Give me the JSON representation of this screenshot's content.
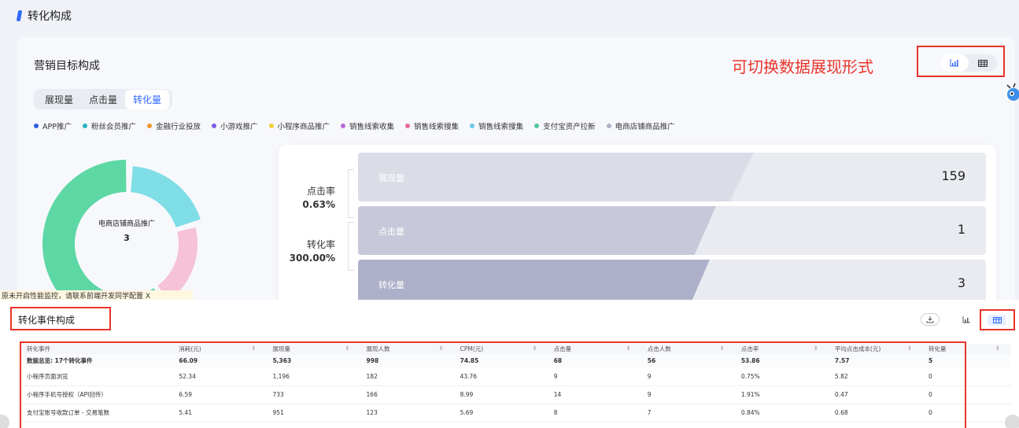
{
  "page": {
    "section_title": "转化构成"
  },
  "top_card": {
    "title": "营销目标构成",
    "annotation": "可切换数据展现形式",
    "view_switch": {
      "chart_icon": "bar-chart-icon",
      "table_icon": "table-grid-icon",
      "active": "chart"
    },
    "tabs": [
      {
        "label": "展现量",
        "active": false
      },
      {
        "label": "点击量",
        "active": false
      },
      {
        "label": "转化量",
        "active": true
      }
    ],
    "legend": [
      {
        "label": "APP推广",
        "color": "#2f5fe0"
      },
      {
        "label": "粉丝会员推广",
        "color": "#26b5c2"
      },
      {
        "label": "金融行业投放",
        "color": "#f0962e"
      },
      {
        "label": "小游戏推广",
        "color": "#7b5ce8"
      },
      {
        "label": "小程序商品推广",
        "color": "#f5cc3a"
      },
      {
        "label": "销售线索收集",
        "color": "#b66ad9"
      },
      {
        "label": "销售线索搜集",
        "color": "#e868a0"
      },
      {
        "label": "销售线索搜集",
        "color": "#6cc8e4"
      },
      {
        "label": "支付宝资产拉新",
        "color": "#4ec99a"
      },
      {
        "label": "电商店铺商品推广",
        "color": "#aab2c4"
      }
    ],
    "donut": {
      "center_label": "电商店铺商品推广",
      "center_value": "3",
      "segments": [
        {
          "label": "电商店铺商品推广",
          "value": 60,
          "color": "#5dd8a5"
        },
        {
          "label": "粉丝会员推广",
          "value": 20,
          "color": "#7fdde6"
        },
        {
          "label": "销售线索搜集",
          "value": 20,
          "color": "#f5c2d6"
        }
      ]
    },
    "funnel": {
      "rates": [
        {
          "label": "点击率",
          "value": "0.63%"
        },
        {
          "label": "转化率",
          "value": "300.00%"
        }
      ],
      "bars": [
        {
          "label": "展现量",
          "value": "159",
          "color": "#dadce6",
          "fill": 0.63
        },
        {
          "label": "点击量",
          "value": "1",
          "color": "#c7c9da",
          "fill": 0.57
        },
        {
          "label": "转化量",
          "value": "3",
          "color": "#aeb0c9",
          "fill": 0.56
        }
      ]
    }
  },
  "tooltip_strip": "原未开启性能监控，请联系前端开发同学配置  X",
  "bottom_card": {
    "title": "转化事件构成",
    "download_icon": "download-icon",
    "chart_icon": "bar-chart-icon",
    "table_icon": "table-grid-icon",
    "table": {
      "headers": [
        "转化事件",
        "消耗(元)",
        "展现量",
        "展现人数",
        "CPM(元)",
        "点击量",
        "点击人数",
        "点击率",
        "平均点击成本(元)",
        "转化量"
      ],
      "summary": [
        "数据总览: 17个转化事件",
        "66.09",
        "5,363",
        "998",
        "74.85",
        "68",
        "56",
        "53.86",
        "7.57",
        "5"
      ],
      "rows": [
        [
          "小程序页面浏览",
          "52.34",
          "1,196",
          "182",
          "43.76",
          "9",
          "9",
          "0.75%",
          "5.82",
          "0"
        ],
        [
          "小程序手机号授权（API回传）",
          "6.59",
          "733",
          "166",
          "8.99",
          "14",
          "9",
          "1.91%",
          "0.47",
          "0"
        ],
        [
          "支付宝账号收款订单 - 交易笔数",
          "5.41",
          "951",
          "123",
          "5.69",
          "8",
          "7",
          "0.84%",
          "0.68",
          "0"
        ]
      ]
    }
  }
}
